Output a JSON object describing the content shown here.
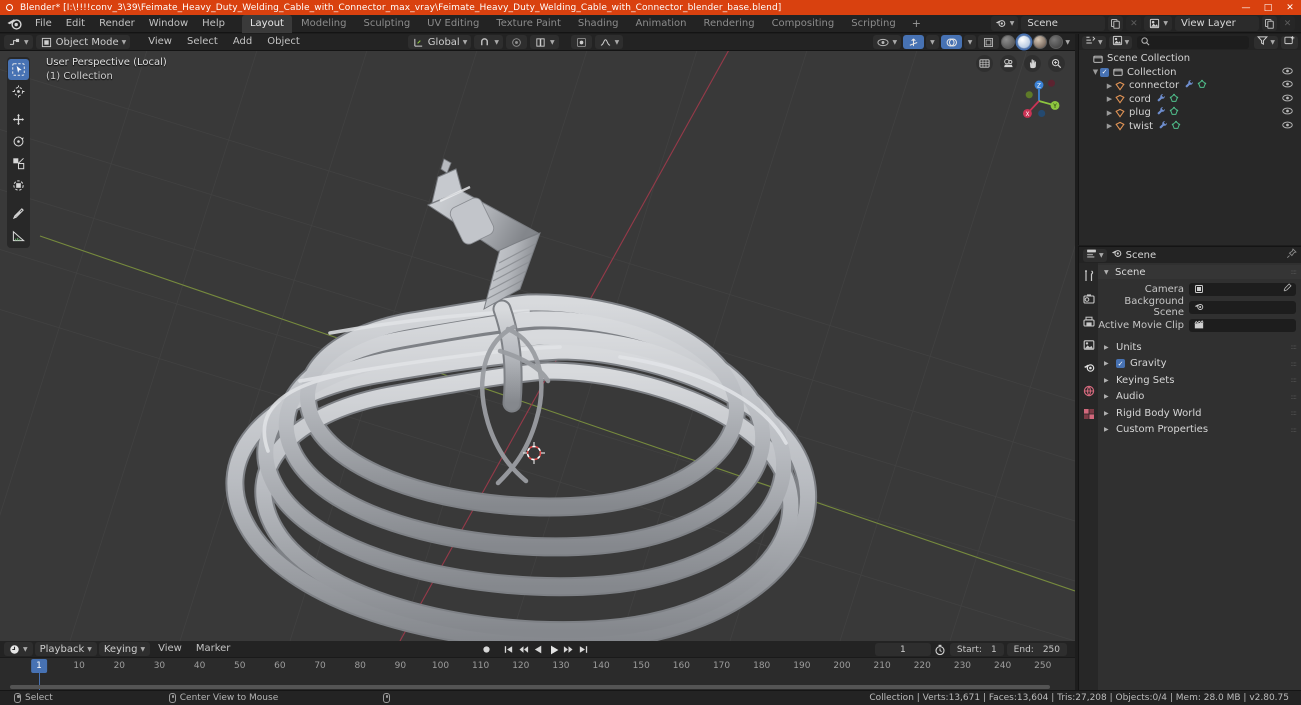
{
  "window": {
    "title": "Blender* [I:\\!!!!conv_3\\39\\Feimate_Heavy_Duty_Welding_Cable_with_Connector_max_vray\\Feimate_Heavy_Duty_Welding_Cable_with_Connector_blender_base.blend]",
    "minimize": "—",
    "maximize": "□",
    "close": "✕",
    "titlebar_color": "#d9410f"
  },
  "topbar": {
    "menus": [
      "File",
      "Edit",
      "Render",
      "Window",
      "Help"
    ],
    "workspaces": [
      {
        "label": "Layout",
        "active": true
      },
      {
        "label": "Modeling",
        "active": false
      },
      {
        "label": "Sculpting",
        "active": false
      },
      {
        "label": "UV Editing",
        "active": false
      },
      {
        "label": "Texture Paint",
        "active": false
      },
      {
        "label": "Shading",
        "active": false
      },
      {
        "label": "Animation",
        "active": false
      },
      {
        "label": "Rendering",
        "active": false
      },
      {
        "label": "Compositing",
        "active": false
      },
      {
        "label": "Scripting",
        "active": false
      }
    ],
    "add_workspace": "+",
    "scene_name": "Scene",
    "view_layer_name": "View Layer",
    "new_scene_icon": "copy-icon",
    "remove_scene_icon": "x-icon",
    "new_viewlayer_icon": "copy-icon",
    "remove_viewlayer_icon": "x-icon"
  },
  "viewport_header": {
    "editor_type": "editor-type-icon",
    "mode": "Object Mode",
    "menus": [
      "View",
      "Select",
      "Add",
      "Object"
    ],
    "transform_orientation": "Global",
    "snap_icon": "magnet-icon",
    "proportional_icon": "proportional-edit-icon",
    "overlays_icon": "overlays-icon",
    "xray_icon": "xray-icon",
    "shading_modes": [
      "wireframe",
      "solid",
      "material-preview",
      "rendered"
    ],
    "active_shading": "solid",
    "visibility_icon": "object-visibility-icon",
    "gizmo_icon": "gizmo-icon"
  },
  "viewport": {
    "overlay_line1": "User Perspective (Local)",
    "overlay_line2": "(1) Collection",
    "tools": [
      {
        "name": "tweak-tool",
        "active": true
      },
      {
        "name": "cursor-tool",
        "active": false
      },
      {
        "name": "move-tool",
        "active": false
      },
      {
        "name": "rotate-tool",
        "active": false
      },
      {
        "name": "scale-tool",
        "active": false
      },
      {
        "name": "transform-tool",
        "active": false
      },
      {
        "name": "annotate-tool",
        "active": false
      },
      {
        "name": "measure-tool",
        "active": false
      }
    ],
    "nav_buttons": [
      "toggle-ortho-icon",
      "camera-view-icon",
      "pan-view-icon",
      "zoom-view-icon"
    ],
    "axis_labels": {
      "x": "X",
      "y": "Y",
      "z": "Z"
    },
    "axis_colors": {
      "x": "#cc3355",
      "y": "#8dc63f",
      "z": "#3b82d6"
    },
    "background_color": "#393939",
    "object_color": "#b9bcc0"
  },
  "outliner": {
    "display_mode": "View Layer",
    "filter_icon": "filter-icon",
    "new_collection_icon": "new-collection-icon",
    "search_placeholder": "",
    "search_value": "",
    "root": "Scene Collection",
    "collection": "Collection",
    "items": [
      {
        "label": "connector",
        "type": "mesh"
      },
      {
        "label": "cord",
        "type": "mesh"
      },
      {
        "label": "plug",
        "type": "mesh"
      },
      {
        "label": "twist",
        "type": "mesh"
      }
    ]
  },
  "properties": {
    "breadcrumb": "Scene",
    "tabs": [
      "tool-tab",
      "render-tab",
      "output-tab",
      "view-layer-tab",
      "scene-tab",
      "world-tab",
      "texture-tab"
    ],
    "panel_title": "Scene",
    "fields": [
      {
        "label": "Camera",
        "value": "",
        "icon": "camera-icon",
        "has_eyedropper": true
      },
      {
        "label": "Background Scene",
        "value": "",
        "icon": "scene-icon",
        "has_eyedropper": false
      },
      {
        "label": "Active Movie Clip",
        "value": "",
        "icon": "clip-icon",
        "has_eyedropper": false
      }
    ],
    "categories": [
      {
        "label": "Units",
        "checkbox": false
      },
      {
        "label": "Gravity",
        "checkbox": true
      },
      {
        "label": "Keying Sets",
        "checkbox": false
      },
      {
        "label": "Audio",
        "checkbox": false
      },
      {
        "label": "Rigid Body World",
        "checkbox": false
      },
      {
        "label": "Custom Properties",
        "checkbox": false
      }
    ]
  },
  "timeline": {
    "editor_icon": "timeline-editor-icon",
    "menus": [
      "Playback",
      "Keying",
      "View",
      "Marker"
    ],
    "transport": [
      "record-icon",
      "jump-start-icon",
      "prev-keyframe-icon",
      "play-reverse-icon",
      "play-icon",
      "next-keyframe-icon",
      "jump-end-icon"
    ],
    "current_frame": "1",
    "auto_key_icon": "auto-keying-icon",
    "start_label": "Start:",
    "start_value": "1",
    "end_label": "End:",
    "end_value": "250",
    "playhead_frame": "1",
    "ticks": [
      10,
      20,
      30,
      40,
      50,
      60,
      70,
      80,
      90,
      100,
      110,
      120,
      130,
      140,
      150,
      160,
      170,
      180,
      190,
      200,
      210,
      220,
      230,
      240,
      250
    ]
  },
  "statusbar": {
    "left_items": [
      {
        "icon": "mouse-left-icon",
        "label": "Select"
      },
      {
        "icon": "mouse-middle-icon",
        "label": "Center View to Mouse"
      },
      {
        "icon": "mouse-right-icon",
        "label": ""
      }
    ],
    "stats": "Collection | Verts:13,671 | Faces:13,604 | Tris:27,208 | Objects:0/4 | Mem: 28.0 MB | v2.80.75"
  }
}
